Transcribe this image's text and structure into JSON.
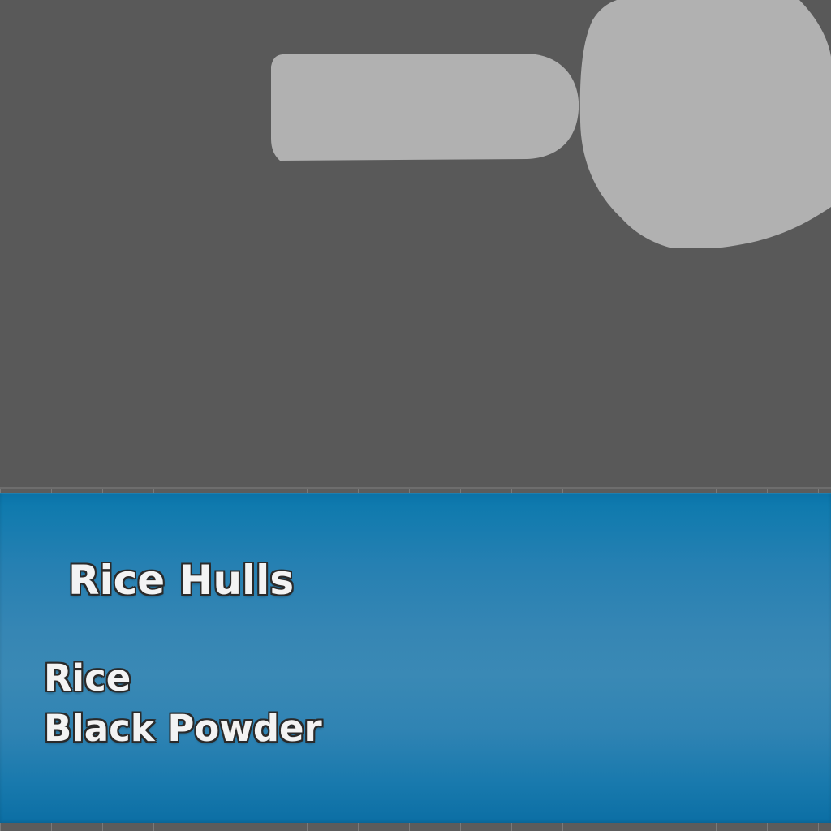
{
  "item": {
    "title": "Rice Hulls",
    "ingredients": [
      {
        "label": "Rice"
      },
      {
        "label": "Black Powder"
      }
    ]
  },
  "colors": {
    "background": "#595959",
    "silhouette": "#b1b1b1",
    "panel_blue": "#2f83b3",
    "text_fill": "#f3f3f3",
    "text_outline": "#2a2a2a"
  },
  "icons": {
    "item_silhouette": "rice-hulls-icon"
  }
}
